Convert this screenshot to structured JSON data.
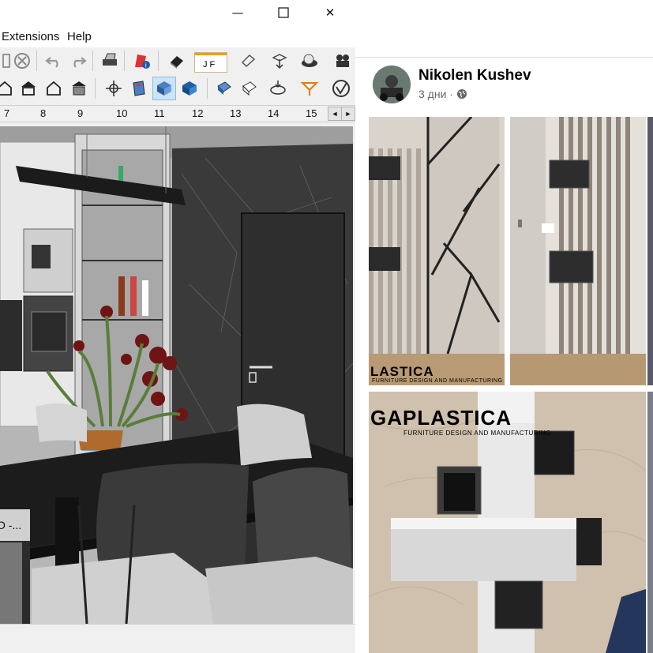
{
  "window": {
    "minimize_glyph": "—",
    "maximize_glyph": "☐",
    "close_glyph": "✕"
  },
  "menu": {
    "items": [
      "Extensions",
      "Help"
    ]
  },
  "ruler": {
    "ticks": [
      "7",
      "8",
      "9",
      "10",
      "11",
      "12",
      "13",
      "14",
      "15"
    ],
    "prev_glyph": "◄",
    "next_glyph": "►"
  },
  "toolbar": {
    "layout_label": "J F"
  },
  "thumbnail_window": {
    "title": "O -..."
  },
  "post": {
    "author": "Nikolen Kushev",
    "time": "3 дни",
    "separator": "·",
    "privacy_icon": "globe-icon"
  },
  "photos": {
    "watermark_small": "LASTICA",
    "watermark_small_sub": "FURNITURE DESIGN AND MANUFACTURING",
    "watermark_large": "GAPLASTICA",
    "watermark_large_sub": "FURNITURE DESIGN AND MANUFACTURING"
  },
  "colors": {
    "fb_text": "#050505",
    "fb_meta": "#65676b",
    "toolbar_bg": "#f0f0f0",
    "active_tool": "#cce4f7"
  }
}
